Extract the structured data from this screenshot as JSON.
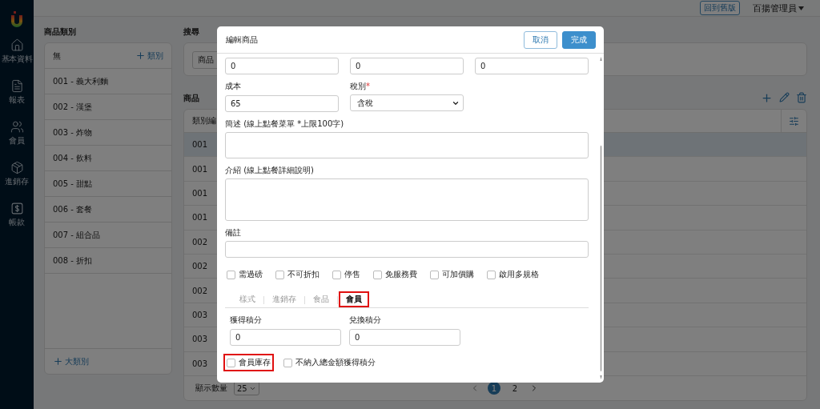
{
  "sidebar": {
    "items": [
      {
        "label": "基本資料"
      },
      {
        "label": "報表"
      },
      {
        "label": "會員"
      },
      {
        "label": "進銷存"
      },
      {
        "label": "帳款"
      }
    ]
  },
  "top_bar": {
    "legacy_button": "回到舊版",
    "user_menu": "百揚管理員"
  },
  "categories": {
    "title": "商品類別",
    "header": "無",
    "add_button": "類別",
    "items": [
      "001 - 義大利麵",
      "002 - 漢堡",
      "003 - 炸物",
      "004 - 飲料",
      "005 - 甜點",
      "006 - 套餐",
      "007 - 組合品",
      "008 - 折扣"
    ],
    "footer_button": "大類別"
  },
  "search": {
    "title": "搜尋",
    "field_value": "商品"
  },
  "products": {
    "title": "商品",
    "table": {
      "columns": [
        "類別編"
      ],
      "rows": [
        {
          "cells": [
            "001"
          ],
          "selected": true
        },
        {
          "cells": [
            "001"
          ],
          "selected": false
        },
        {
          "cells": [
            "001"
          ],
          "selected": false
        },
        {
          "cells": [
            "001"
          ],
          "selected": false
        },
        {
          "cells": [
            "002"
          ],
          "selected": false
        },
        {
          "cells": [
            "002"
          ],
          "selected": false
        },
        {
          "cells": [
            "002"
          ],
          "selected": false
        },
        {
          "cells": [
            "003"
          ],
          "selected": false
        },
        {
          "cells": [
            "003"
          ],
          "selected": false
        },
        {
          "cells": [
            "003"
          ],
          "selected": false
        }
      ]
    },
    "page_size_label": "顯示數量",
    "page_size": "25",
    "pages": [
      {
        "label": "1",
        "selected": true
      },
      {
        "label": "2",
        "selected": false
      }
    ]
  },
  "modal": {
    "title": "編輯商品",
    "buttons": [
      {
        "label": "取消",
        "kind": "secondary"
      },
      {
        "label": "完成",
        "kind": "primary"
      }
    ],
    "top_fields": [
      "0",
      "0",
      "0"
    ],
    "fields": [
      {
        "kind": "input",
        "label": "成本",
        "value": "65"
      },
      {
        "kind": "select",
        "label": "稅別",
        "required_mark": "*",
        "value": "含稅"
      }
    ],
    "short_description": {
      "label": "簡述 (線上點餐菜單 *上限100字)"
    },
    "introduction": {
      "label": "介紹 (線上點餐詳細說明)"
    },
    "note": {
      "label": "備註"
    },
    "options": [
      {
        "label": "需過磅",
        "checked": false
      },
      {
        "label": "不可折扣",
        "checked": false
      },
      {
        "label": "停售",
        "checked": false
      },
      {
        "label": "免服務費",
        "checked": false
      },
      {
        "label": "可加價購",
        "checked": false
      },
      {
        "label": "啟用多規格",
        "checked": false
      }
    ],
    "tabs": [
      {
        "label": "樣式",
        "selected": false,
        "highlighted": false
      },
      {
        "label": "進銷存",
        "selected": false,
        "highlighted": false
      },
      {
        "label": "食品",
        "selected": false,
        "highlighted": false
      },
      {
        "label": "會員",
        "selected": true,
        "highlighted": true
      }
    ],
    "points_fields": [
      {
        "label": "獲得積分",
        "value": "0"
      },
      {
        "label": "兌換積分",
        "value": "0"
      }
    ],
    "member_options": [
      {
        "label": "會員庫存",
        "checked": false,
        "highlighted": true
      },
      {
        "label": "不納入總金額獲得積分",
        "checked": false,
        "highlighted": false
      }
    ]
  }
}
